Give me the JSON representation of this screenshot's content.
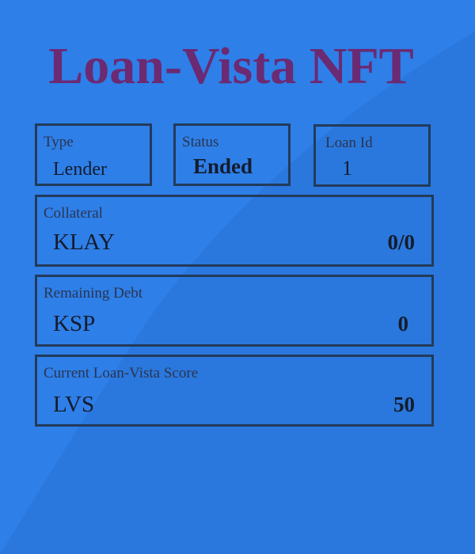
{
  "title": "Loan-Vista NFT",
  "colors": {
    "background": "#2e7fe8",
    "title": "#6b2a72",
    "border": "#233a5a"
  },
  "type": {
    "label": "Type",
    "value": "Lender"
  },
  "status": {
    "label": "Status",
    "value": "Ended"
  },
  "loan_id": {
    "label": "Loan Id",
    "value": "1"
  },
  "collateral": {
    "label": "Collateral",
    "token": "KLAY",
    "amount": "0/0"
  },
  "remaining_debt": {
    "label": "Remaining Debt",
    "token": "KSP",
    "amount": "0"
  },
  "score": {
    "label": "Current Loan-Vista Score",
    "token": "LVS",
    "amount": "50"
  }
}
